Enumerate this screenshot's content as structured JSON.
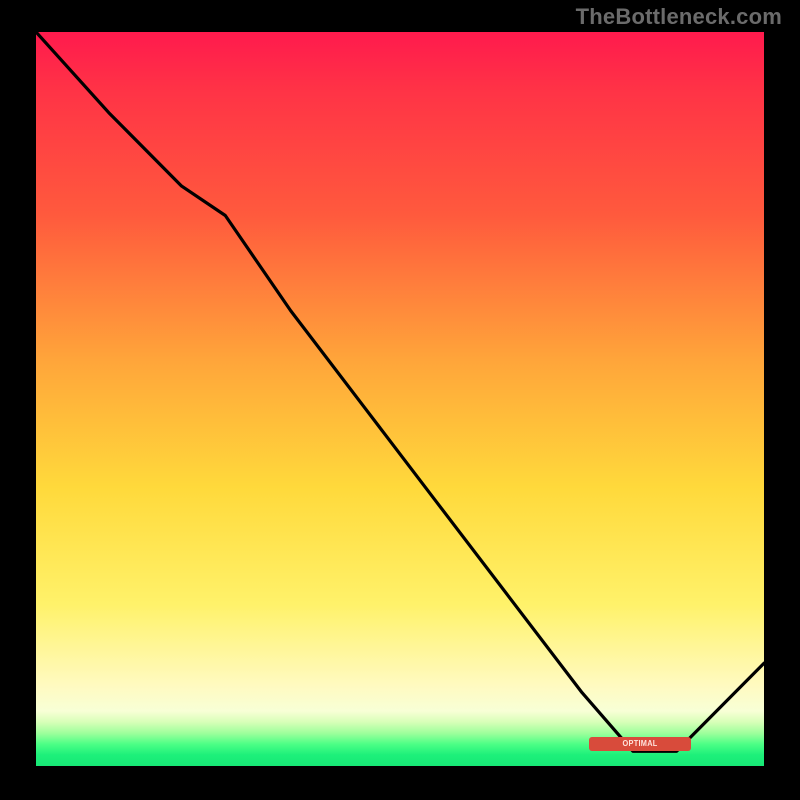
{
  "watermark": "TheBottleneck.com",
  "chart_data": {
    "type": "line",
    "title": "",
    "xlabel": "",
    "ylabel": "",
    "xlim": [
      0,
      100
    ],
    "ylim": [
      0,
      100
    ],
    "grid": false,
    "legend": false,
    "series": [
      {
        "name": "curve",
        "x": [
          0,
          10,
          20,
          26,
          35,
          45,
          55,
          65,
          75,
          82,
          88,
          100
        ],
        "values": [
          100,
          89,
          79,
          75,
          62,
          49,
          36,
          23,
          10,
          2,
          2,
          14
        ]
      }
    ],
    "background_bands": [
      {
        "from_y": 100,
        "to_y": 8,
        "color_top": "#ff1a4d",
        "color_bottom": "#fffac0"
      },
      {
        "from_y": 8,
        "to_y": 0,
        "color_top": "#f8ffd6",
        "color_bottom": "#17e876"
      }
    ],
    "marker": {
      "label": "OPTIMAL",
      "x_from": 76,
      "x_to": 90,
      "y": 3
    }
  }
}
